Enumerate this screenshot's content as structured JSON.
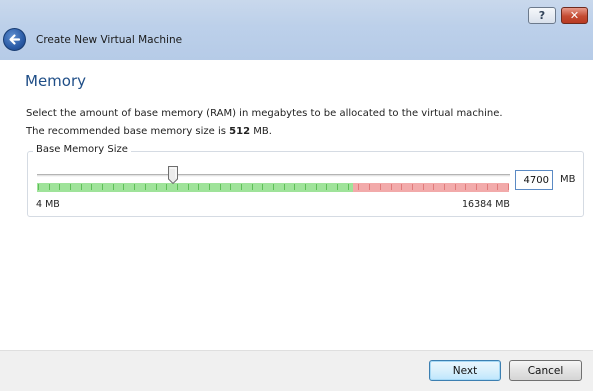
{
  "window": {
    "title": "Create New Virtual Machine",
    "help_label": "?",
    "close_label": "✕"
  },
  "page": {
    "heading": "Memory",
    "description_line1": "Select the amount of base memory (RAM) in megabytes to be allocated to the virtual machine.",
    "recommend_prefix": "The recommended base memory size is ",
    "recommend_value": "512",
    "recommend_suffix": " MB."
  },
  "memory": {
    "group_title": "Base Memory Size",
    "value": "4700",
    "value_mb": 4700,
    "unit": "MB",
    "min_label": "4 MB",
    "max_label": "16384 MB",
    "min_mb": 4,
    "max_mb": 16384,
    "green_fraction": 0.67,
    "colors": {
      "safe": "#9fe39a",
      "danger": "#f2aaaa"
    }
  },
  "footer": {
    "next_label": "Next",
    "cancel_label": "Cancel"
  },
  "icons": {
    "back": "back-arrow-icon",
    "help": "help-icon",
    "close": "close-icon"
  }
}
